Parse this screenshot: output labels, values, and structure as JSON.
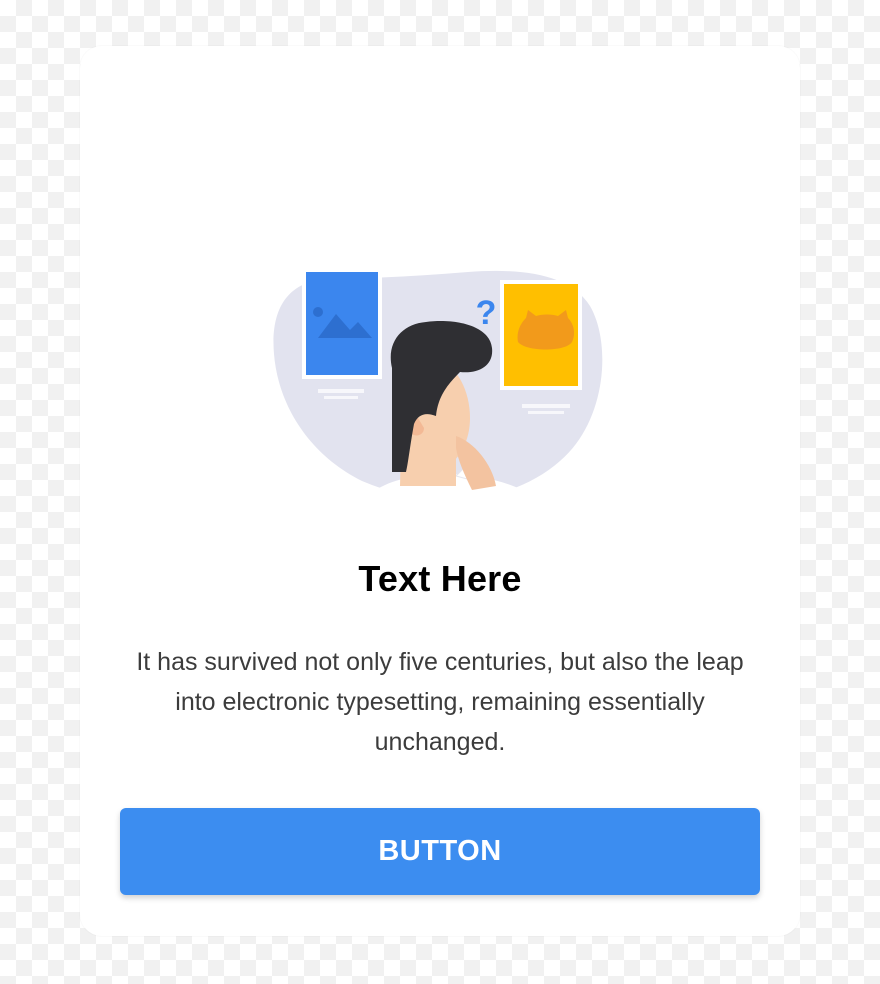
{
  "card": {
    "title": "Text Here",
    "description": "It has survived not only five centuries, but also the leap into electronic typesetting, remaining essentially unchanged.",
    "button_label": "BUTTON"
  },
  "illustration": {
    "question_mark": "?",
    "icons": [
      "person-thinking-illustration",
      "image-card-icon",
      "cat-card-icon",
      "question-mark-icon"
    ]
  },
  "colors": {
    "accent": "#3c8df0",
    "blob": "#e2e3ef",
    "blue_card": "#3b86ee",
    "yellow_card": "#ffbf00",
    "hair": "#2f2f33",
    "skin": "#f7cfae",
    "title": "#000000",
    "body_text": "#3c3c3c"
  }
}
